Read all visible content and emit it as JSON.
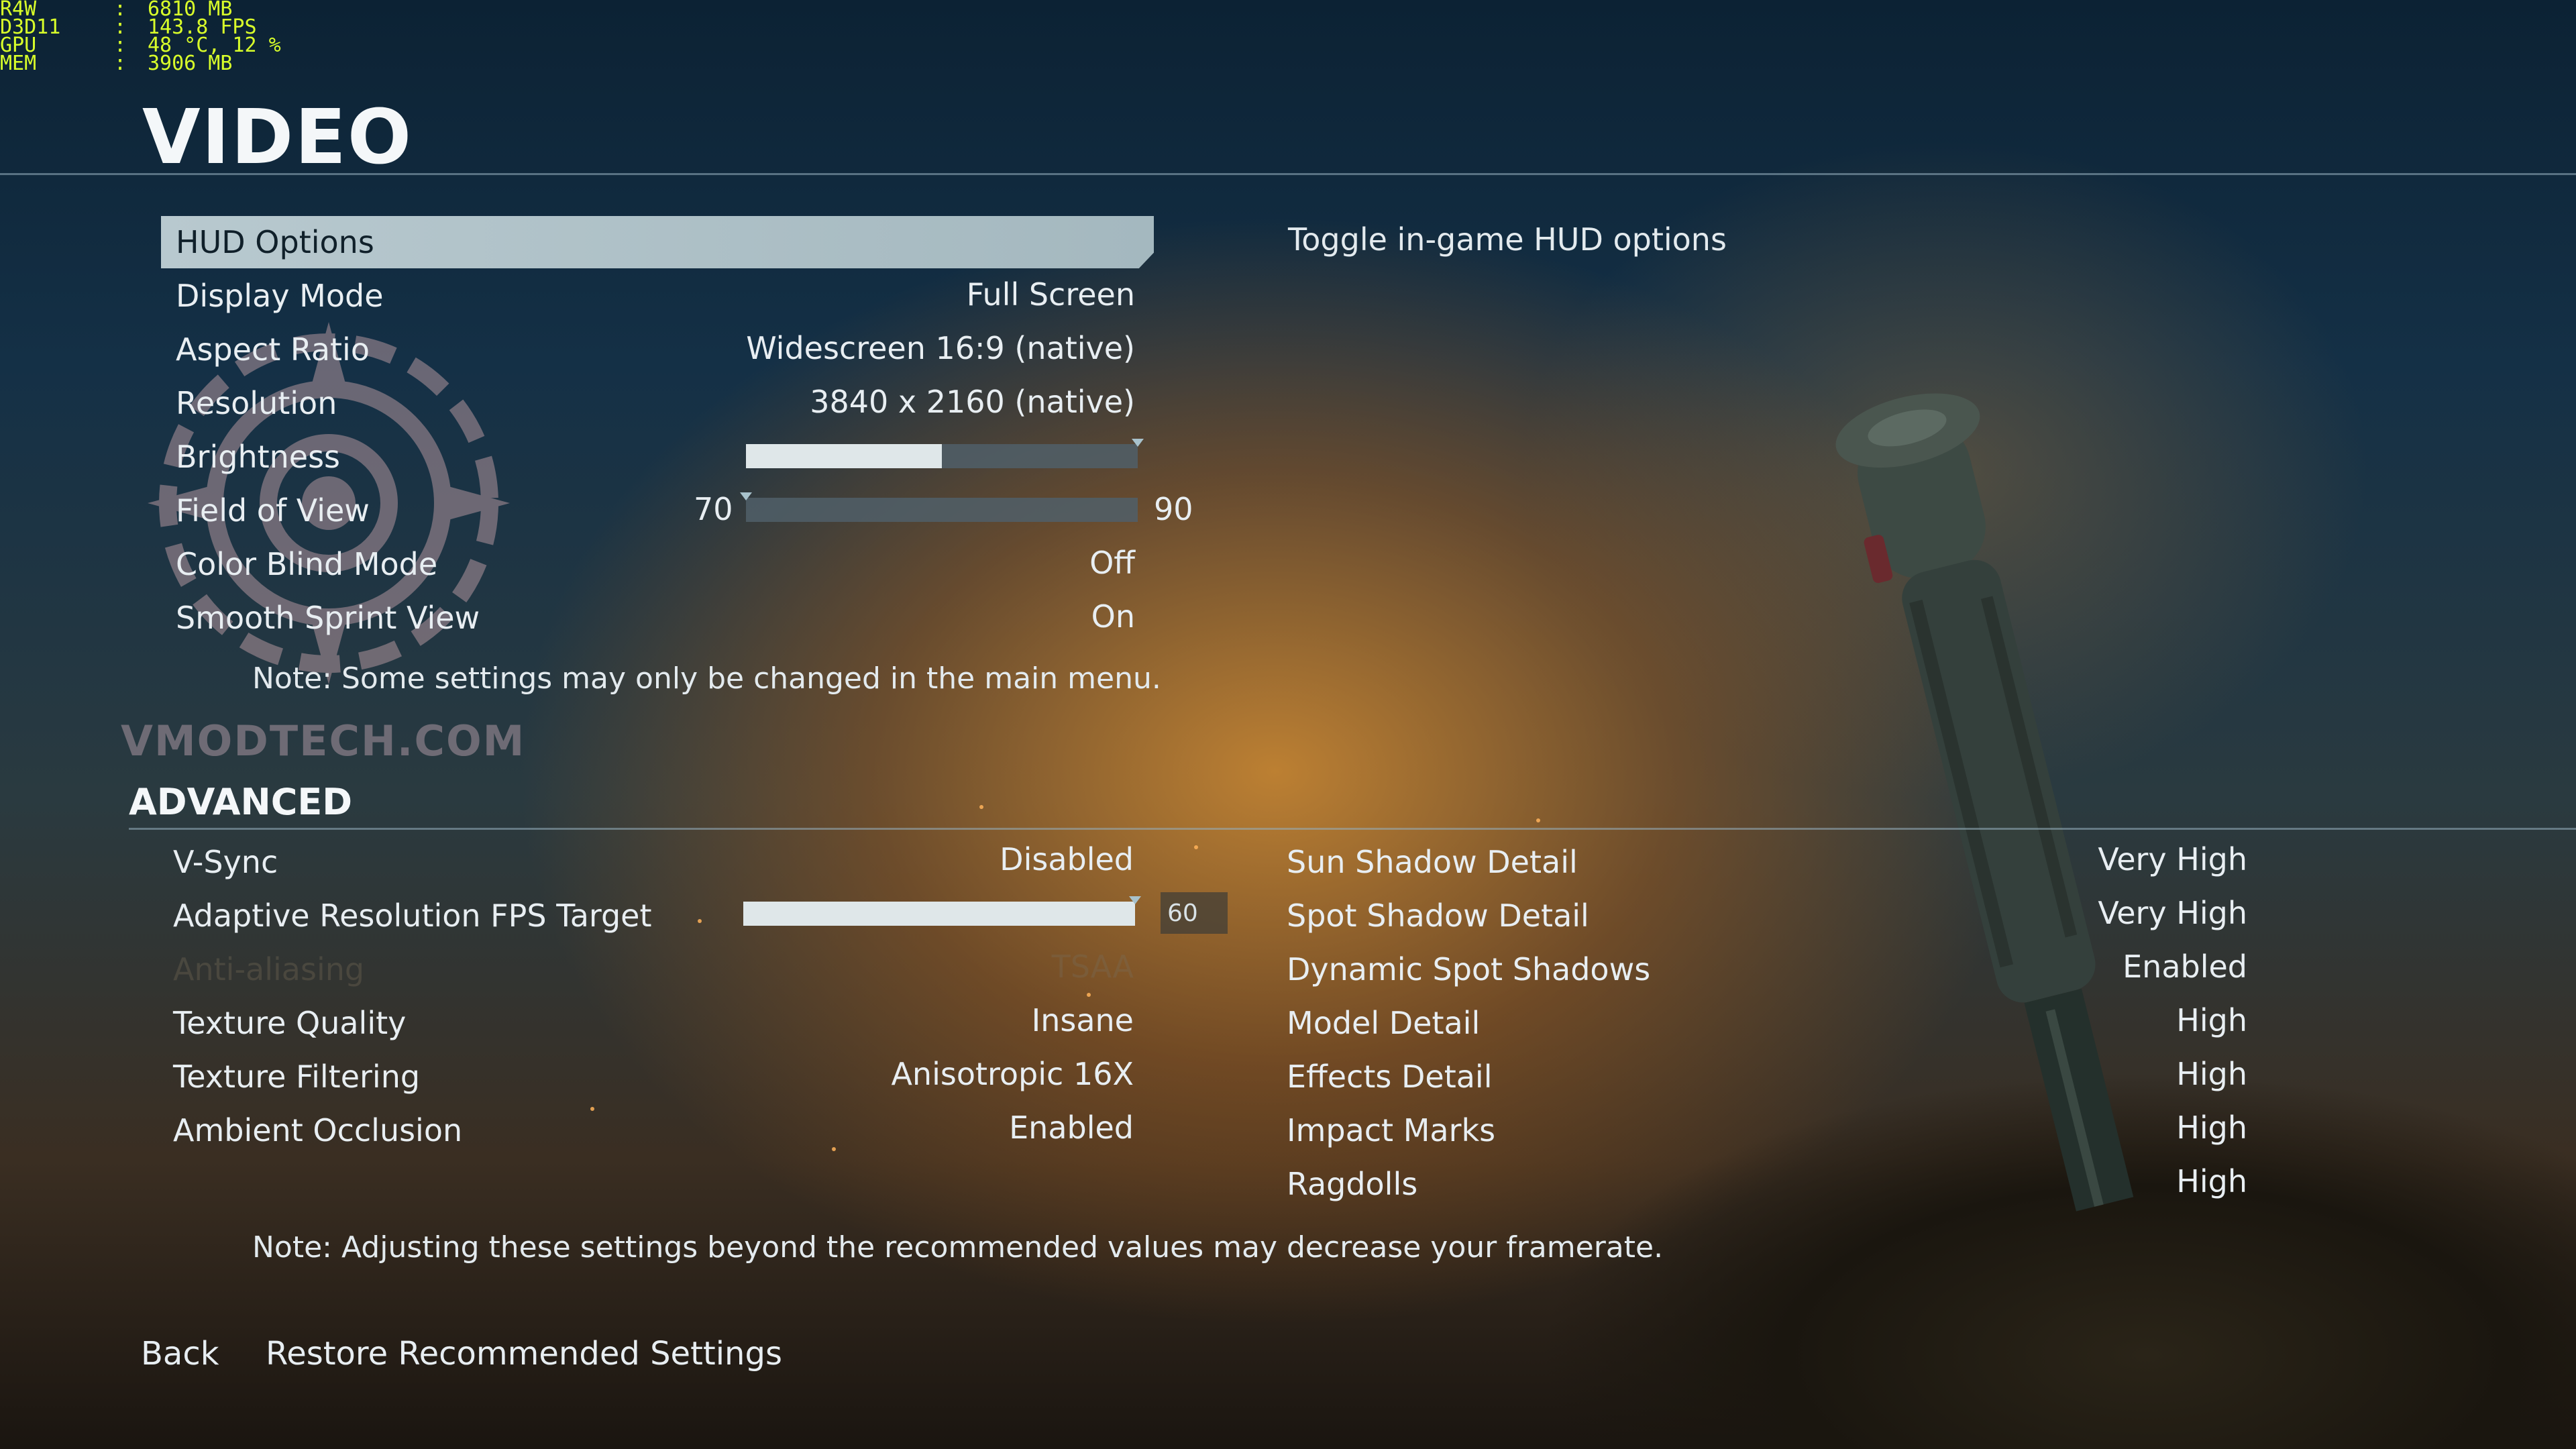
{
  "osd": {
    "rows": [
      {
        "key": "R4W",
        "value": "6810 MB"
      },
      {
        "key": "D3D11",
        "value": "143.8 FPS"
      },
      {
        "key": "GPU",
        "value": "48 °C, 12 %"
      },
      {
        "key": "MEM",
        "value": "3906 MB"
      }
    ],
    "sep": ":"
  },
  "page_title": "VIDEO",
  "basic": [
    {
      "label": "HUD Options",
      "value": ""
    },
    {
      "label": "Display Mode",
      "value": "Full Screen"
    },
    {
      "label": "Aspect Ratio",
      "value": "Widescreen 16:9 (native)"
    },
    {
      "label": "Resolution",
      "value": "3840 x 2160 (native)"
    },
    {
      "label": "Brightness",
      "value": ""
    },
    {
      "label": "Field of View",
      "value": ""
    },
    {
      "label": "Color Blind Mode",
      "value": "Off"
    },
    {
      "label": "Smooth Sprint View",
      "value": "On"
    }
  ],
  "brightness": {
    "level": 0.5
  },
  "fov": {
    "min": "70",
    "max": "90",
    "level": 0.0
  },
  "description": "Toggle in-game HUD options",
  "note_main": "Note: Some settings may only be changed in the main menu.",
  "watermark": "VMODTECH.COM",
  "advanced": {
    "title": "ADVANCED",
    "left": [
      {
        "label": "V-Sync",
        "value": "Disabled"
      },
      {
        "label": "Adaptive Resolution FPS Target",
        "value": ""
      },
      {
        "label": "Anti-aliasing",
        "value": "TSAA"
      },
      {
        "label": "Texture Quality",
        "value": "Insane"
      },
      {
        "label": "Texture Filtering",
        "value": "Anisotropic 16X"
      },
      {
        "label": "Ambient Occlusion",
        "value": "Enabled"
      }
    ],
    "fps_target": {
      "value": "60",
      "level": 1.0
    },
    "right": [
      {
        "label": "Sun Shadow Detail",
        "value": "Very High"
      },
      {
        "label": "Spot Shadow Detail",
        "value": "Very High"
      },
      {
        "label": "Dynamic Spot Shadows",
        "value": "Enabled"
      },
      {
        "label": "Model Detail",
        "value": "High"
      },
      {
        "label": "Effects Detail",
        "value": "High"
      },
      {
        "label": "Impact Marks",
        "value": "High"
      },
      {
        "label": "Ragdolls",
        "value": "High"
      }
    ]
  },
  "note_adv": "Note: Adjusting these settings beyond the recommended values may decrease your framerate.",
  "footer": {
    "back": "Back",
    "restore": "Restore Recommended Settings"
  }
}
